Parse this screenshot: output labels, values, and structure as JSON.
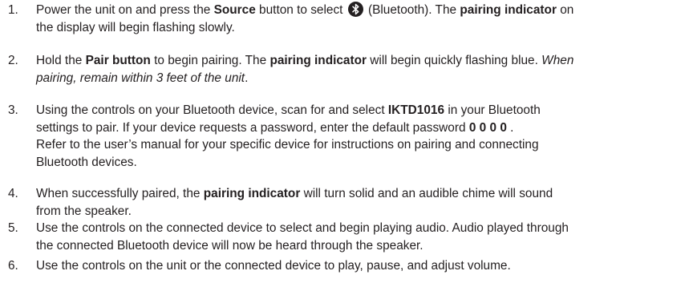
{
  "steps": [
    {
      "num": "1.",
      "l1a": "Power the unit on and press the ",
      "l1b": "Source",
      "l1c": " button to select ",
      "l1d": " (Bluetooth). The ",
      "l1e": "pairing indicator",
      "l1f": " on",
      "l2": "the display will begin flashing slowly."
    },
    {
      "num": "2.",
      "l1a": "Hold the ",
      "l1b": "Pair button",
      "l1c": " to begin pairing. The ",
      "l1d": "pairing indicator",
      "l1e": " will begin quickly flashing blue. ",
      "l1f": "When",
      "l2": "pairing, remain within 3 feet of the unit",
      "l2b": "."
    },
    {
      "num": "3.",
      "l1a": "Using the controls on your Bluetooth device, scan for and select ",
      "l1b": "IKTD1016",
      "l1c": " in your Bluetooth",
      "l2a": "settings to pair. If your device requests a password, enter the default password ",
      "l2b": "0 0 0 0",
      "l2c": " .",
      "l3": "Refer to the user’s manual for your specific device for instructions on pairing and connecting",
      "l4": "Bluetooth devices."
    },
    {
      "num": "4.",
      "l1a": "When successfully paired, the ",
      "l1b": "pairing indicator",
      "l1c": " will turn solid and an audible chime will sound",
      "l2": "from the speaker."
    },
    {
      "num": "5.",
      "l1": "Use the controls on the connected device to select and begin playing audio. Audio played through",
      "l2": "the connected Bluetooth device will now be heard through the speaker."
    },
    {
      "num": "6.",
      "l1": "Use the controls on the unit or the connected device to play, pause, and adjust volume."
    }
  ],
  "icons": {
    "bluetooth": "bluetooth-icon"
  }
}
